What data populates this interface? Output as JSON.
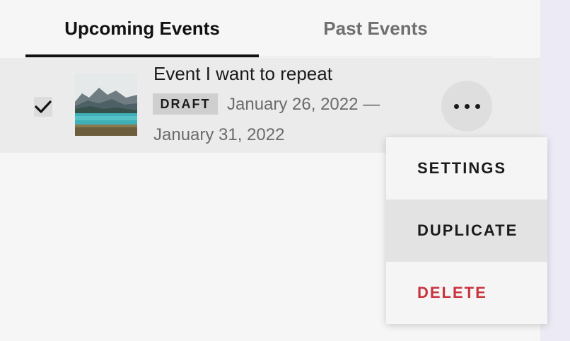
{
  "tabs": [
    {
      "label": "Upcoming Events",
      "active": true
    },
    {
      "label": "Past Events",
      "active": false
    }
  ],
  "event": {
    "title": "Event I want to repeat",
    "status": "DRAFT",
    "date_start": "January 26, 2022 —",
    "date_end": "January 31, 2022",
    "selected": true,
    "thumbnail": "mountain-lake-photo"
  },
  "menu": {
    "items": [
      {
        "label": "SETTINGS"
      },
      {
        "label": "DUPLICATE"
      },
      {
        "label": "DELETE"
      }
    ]
  },
  "colors": {
    "accent_danger": "#c9333e",
    "row_bg": "#ebebeb",
    "badge_bg": "#cfcfcf",
    "page_bg": "#f6f6f6"
  }
}
